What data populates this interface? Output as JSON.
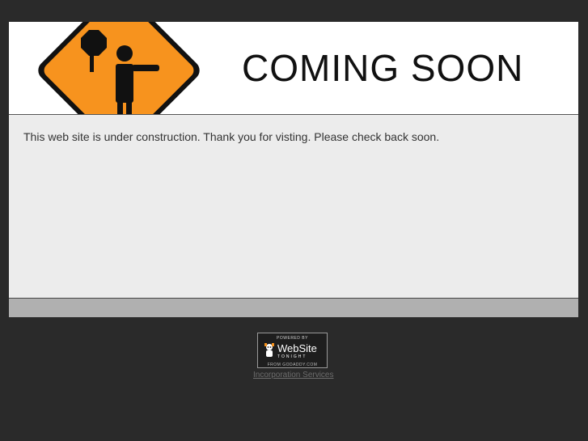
{
  "header": {
    "title": "COMING SOON"
  },
  "content": {
    "message": "This web site is under construction. Thank you for visting. Please check back soon."
  },
  "badge": {
    "top_text": "POWERED BY",
    "main_text": "WebSite",
    "sub_text": "TONIGHT",
    "from_text": "FROM GODADDY.COM"
  },
  "footer": {
    "link_text": "Incorporation Services"
  },
  "colors": {
    "page_background": "#2a2a2a",
    "content_background": "#ececec",
    "footer_bar": "#b0b0b0",
    "sign_orange": "#f7931e"
  },
  "icons": {
    "sign": "construction-flagger-sign-icon",
    "badge_mascot": "mascot-icon"
  }
}
